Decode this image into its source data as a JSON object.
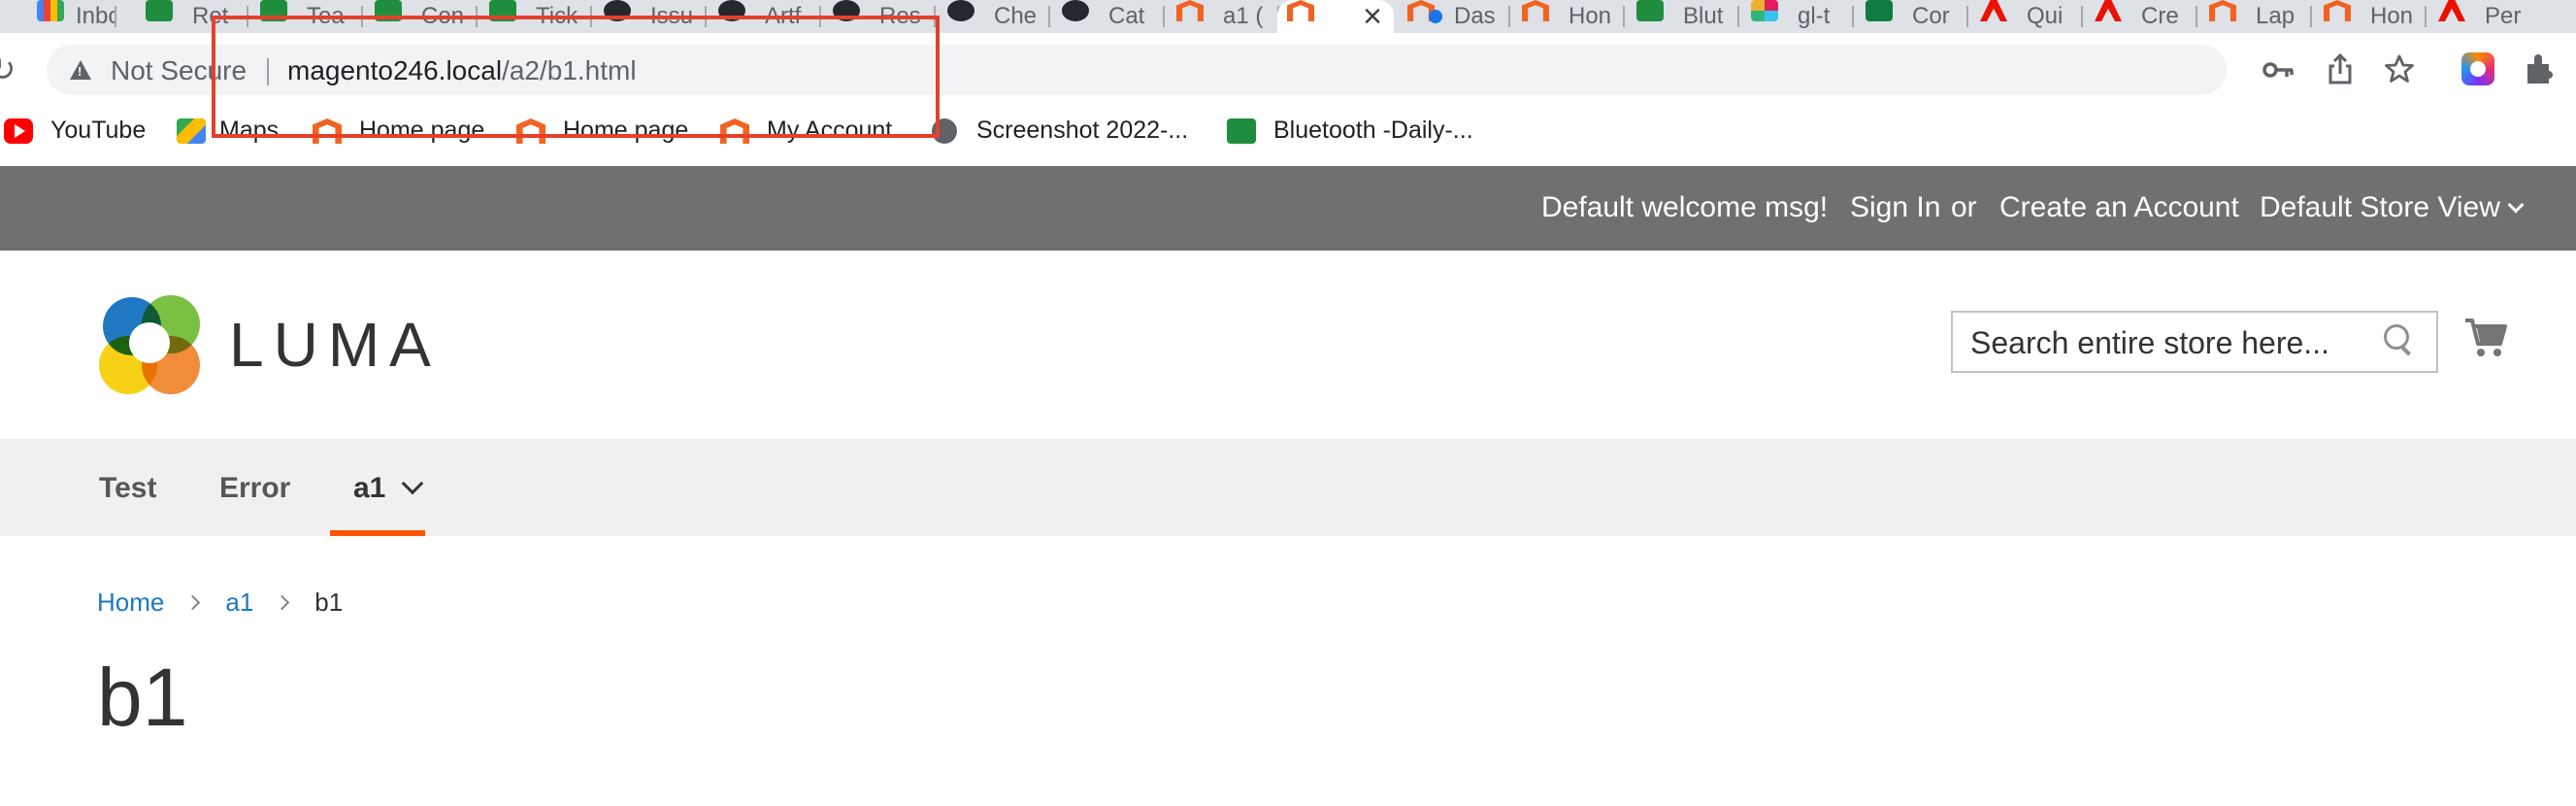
{
  "browser": {
    "tabs": [
      {
        "label": "Inbo",
        "favicon": "gmail-icon"
      },
      {
        "label": "Ret",
        "favicon": "sheets-icon"
      },
      {
        "label": "Tea",
        "favicon": "sheets-icon"
      },
      {
        "label": "Con",
        "favicon": "sheets-icon"
      },
      {
        "label": "Tick",
        "favicon": "sheets-icon"
      },
      {
        "label": "Issu",
        "favicon": "github-icon"
      },
      {
        "label": "Artf",
        "favicon": "github-icon"
      },
      {
        "label": "Res",
        "favicon": "github-icon"
      },
      {
        "label": "Che",
        "favicon": "github-icon"
      },
      {
        "label": "Cat",
        "favicon": "github-icon"
      },
      {
        "label": "a1 (",
        "favicon": "magento-icon"
      },
      {
        "label": "",
        "favicon": "magento-icon"
      },
      {
        "label": "Das",
        "favicon": "magento-icon"
      },
      {
        "label": "Hon",
        "favicon": "magento-icon"
      },
      {
        "label": "Blut",
        "favicon": "sheets-icon"
      },
      {
        "label": "gl-t",
        "favicon": "slack-icon"
      },
      {
        "label": "Cor",
        "favicon": "excel-icon"
      },
      {
        "label": "Qui",
        "favicon": "adobe-icon"
      },
      {
        "label": "Cre",
        "favicon": "adobe-icon"
      },
      {
        "label": "Lap",
        "favicon": "magento-icon"
      },
      {
        "label": "Hon",
        "favicon": "magento-icon"
      },
      {
        "label": "Per",
        "favicon": "adobe-icon"
      }
    ],
    "security_label": "Not Secure",
    "url_host": "magento246.local",
    "url_path": "/a2/b1.html",
    "bookmarks": [
      {
        "label": "YouTube",
        "icon": "youtube-icon"
      },
      {
        "label": "Maps",
        "icon": "maps-icon"
      },
      {
        "label": "Home page",
        "icon": "magento-icon"
      },
      {
        "label": "Home page",
        "icon": "magento-icon"
      },
      {
        "label": "My Account",
        "icon": "magento-icon"
      },
      {
        "label": "Screenshot 2022-...",
        "icon": "globe-icon"
      },
      {
        "label": "Bluetooth -Daily-...",
        "icon": "sheets-icon"
      }
    ],
    "accent_colors": {
      "highlight_box": "#e5402c"
    }
  },
  "store": {
    "header": {
      "welcome": "Default welcome msg!",
      "sign_in": "Sign In",
      "or": "or",
      "create_account": "Create an Account",
      "store_view": "Default Store View"
    },
    "logo_text": "LUMA",
    "search": {
      "placeholder": "Search entire store here..."
    },
    "nav": [
      {
        "label": "Test"
      },
      {
        "label": "Error"
      },
      {
        "label": "a1",
        "active": true
      }
    ],
    "breadcrumb": {
      "home": "Home",
      "parent": "a1",
      "current": "b1"
    },
    "page_title": "b1",
    "colors": {
      "header_bar": "#6e716e",
      "nav_active": "#ff5501",
      "link": "#1979c3"
    }
  }
}
